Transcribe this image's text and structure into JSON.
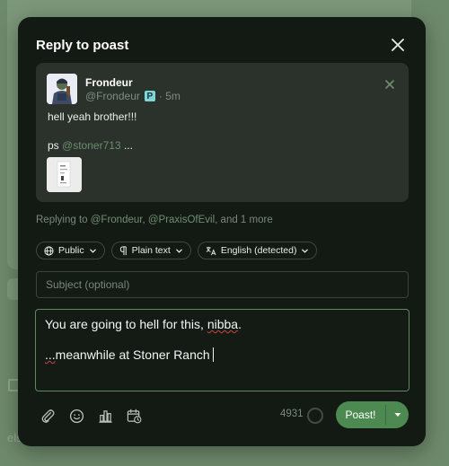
{
  "background": {
    "text": "else."
  },
  "modal": {
    "title": "Reply to poast",
    "quoted": {
      "name": "Frondeur",
      "handle": "@Frondeur",
      "time": "· 5m",
      "body_line1": "hell yeah brother!!!",
      "body_ps": "ps",
      "body_mention": "@stoner713",
      "body_ellipsis": "...",
      "badge": "P"
    },
    "replying": {
      "prefix": "Replying to",
      "mention1": "@Frondeur",
      "sep": ",",
      "mention2": "@PraxisOfEvil",
      "suffix": ", and 1 more"
    },
    "options": {
      "visibility": "Public",
      "format": "Plain text",
      "language": "English (detected)"
    },
    "subject": {
      "placeholder": "Subject (optional)"
    },
    "compose": {
      "line1_pre": "You are going to hell for this, ",
      "line1_word": "nibba",
      "line1_post": ".",
      "line2_squiggle": "...",
      "line2_rest": "meanwhile at Stoner Ranch"
    },
    "footer": {
      "char_count": "4931",
      "post_label": "Poast!"
    }
  },
  "colors": {
    "accent": "#4d8a51",
    "modal_bg": "#131a14",
    "quote_bg": "#2a322b",
    "mention": "#6f8f6f"
  },
  "icons": [
    "close-icon",
    "paperclip-icon",
    "emoji-icon",
    "poll-icon",
    "schedule-icon",
    "globe-icon",
    "pilcrow-icon",
    "translate-icon",
    "chevron-down-icon"
  ]
}
